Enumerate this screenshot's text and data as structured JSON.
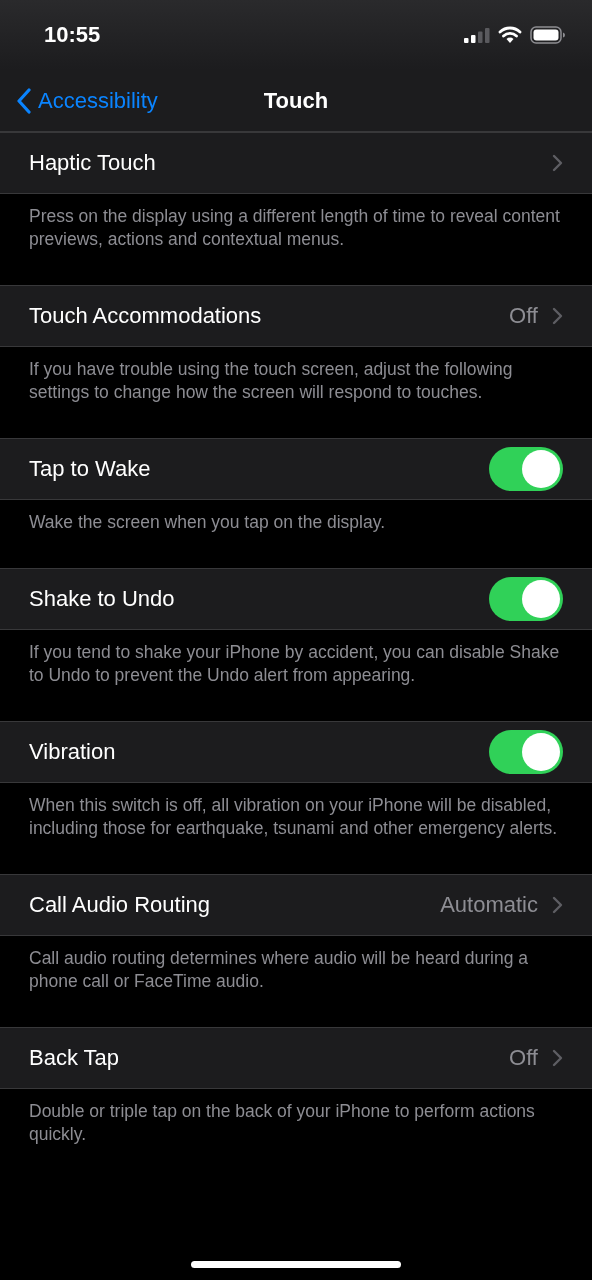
{
  "status_bar": {
    "time": "10:55"
  },
  "nav": {
    "back_label": "Accessibility",
    "title": "Touch"
  },
  "sections": [
    {
      "kind": "link",
      "label": "Haptic Touch",
      "footer": "Press on the display using a different length of time to reveal content previews, actions and contextual menus."
    },
    {
      "kind": "link",
      "label": "Touch Accommodations",
      "value": "Off",
      "footer": "If you have trouble using the touch screen, adjust the following settings to change how the screen will respond to touches."
    },
    {
      "kind": "toggle",
      "label": "Tap to Wake",
      "on": true,
      "footer": "Wake the screen when you tap on the display."
    },
    {
      "kind": "toggle",
      "label": "Shake to Undo",
      "on": true,
      "footer": "If you tend to shake your iPhone by accident, you can disable Shake to Undo to prevent the Undo alert from appearing."
    },
    {
      "kind": "toggle",
      "label": "Vibration",
      "on": true,
      "footer": "When this switch is off, all vibration on your iPhone will be disabled, including those for earthquake, tsunami and other emergency alerts."
    },
    {
      "kind": "link",
      "label": "Call Audio Routing",
      "value": "Automatic",
      "footer": "Call audio routing determines where audio will be heard during a phone call or FaceTime audio."
    },
    {
      "kind": "link",
      "label": "Back Tap",
      "value": "Off",
      "footer": "Double or triple tap on the back of your iPhone to perform actions quickly."
    }
  ]
}
